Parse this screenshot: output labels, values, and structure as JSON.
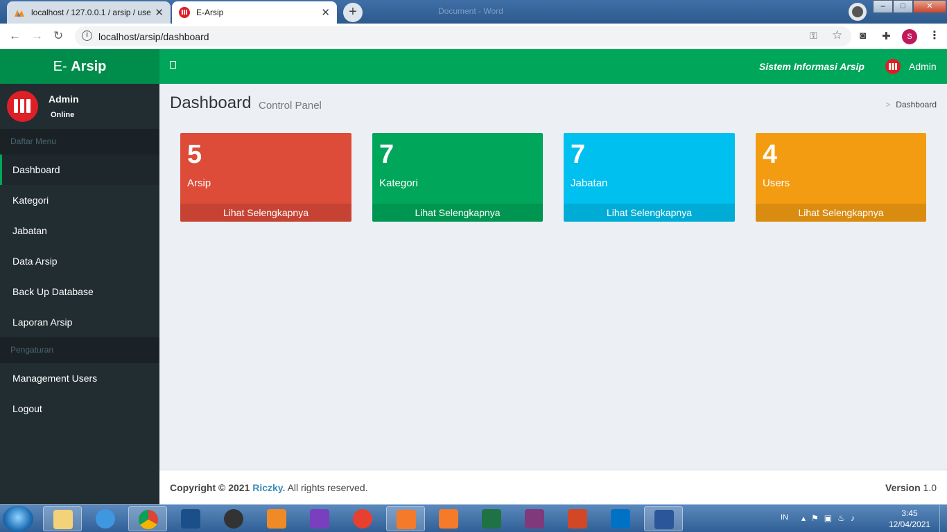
{
  "browser": {
    "tabs": [
      {
        "title": "localhost / 127.0.0.1 / arsip / user",
        "active": false
      },
      {
        "title": "E-Arsip",
        "active": true
      }
    ],
    "new_tab": "+",
    "ghost_title": "Document - Word",
    "url": "localhost/arsip/dashboard",
    "profile_initial": "S",
    "window_controls": {
      "minimize": "–",
      "maximize": "□",
      "close": "✕"
    }
  },
  "app": {
    "logo_prefix": "E- ",
    "logo_bold": "Arsip",
    "header_title": "Sistem Informasi Arsip",
    "header_user": "Admin",
    "accent_color": "#00a65a"
  },
  "sidebar": {
    "user_name": "Admin",
    "user_status": "Online",
    "section_menu": "Daftar Menu",
    "items": [
      {
        "label": "Dashboard",
        "active": true
      },
      {
        "label": "Kategori"
      },
      {
        "label": "Jabatan"
      },
      {
        "label": "Data Arsip"
      },
      {
        "label": "Back Up Database"
      },
      {
        "label": "Laporan Arsip"
      }
    ],
    "section_settings": "Pengaturan",
    "settings_items": [
      {
        "label": "Management Users"
      },
      {
        "label": "Logout"
      }
    ]
  },
  "content": {
    "title": "Dashboard",
    "subtitle": "Control Panel",
    "breadcrumb": "Dashboard",
    "boxes": [
      {
        "count": "5",
        "label": "Arsip",
        "link": "Lihat Selengkapnya",
        "color": "#dd4b39"
      },
      {
        "count": "7",
        "label": "Kategori",
        "link": "Lihat Selengkapnya",
        "color": "#00a65a"
      },
      {
        "count": "7",
        "label": "Jabatan",
        "link": "Lihat Selengkapnya",
        "color": "#00c0ef"
      },
      {
        "count": "4",
        "label": "Users",
        "link": "Lihat Selengkapnya",
        "color": "#f39c12"
      }
    ]
  },
  "footer": {
    "copyright": "Copyright © 2021 ",
    "author": "Riczky.",
    "rights": " All rights reserved.",
    "version_label": "Version",
    "version_value": " 1.0"
  },
  "taskbar": {
    "language": "IN",
    "time": "3:45",
    "date": "12/04/2021"
  }
}
